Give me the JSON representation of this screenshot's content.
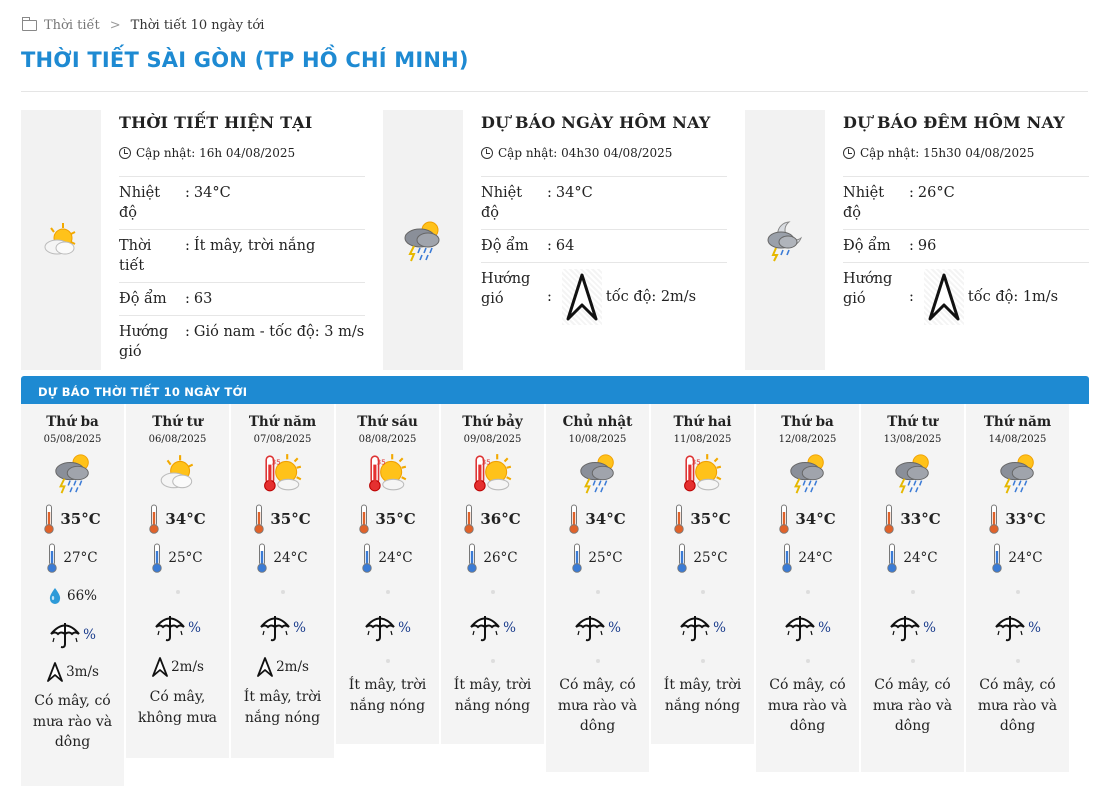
{
  "breadcrumb": {
    "root": "Thời tiết",
    "current": "Thời tiết 10 ngày tới"
  },
  "page_title": "THỜI TIẾT SÀI GÒN (TP HỒ CHÍ MINH)",
  "cards": [
    {
      "title": "THỜI TIẾT HIỆN TẠI",
      "updated": "Cập nhật: 16h 04/08/2025",
      "icon": "sun-cloud-icon",
      "rows": [
        {
          "k": "Nhiệt độ",
          "v": "34°C"
        },
        {
          "k": "Thời tiết",
          "v": "Ít mây, trời nắng"
        },
        {
          "k": "Độ ẩm",
          "v": "63"
        },
        {
          "k": "Hướng gió",
          "v": "Gió nam - tốc độ: 3 m/s"
        }
      ]
    },
    {
      "title": "DỰ BÁO NGÀY HÔM NAY",
      "updated": "Cập nhật: 04h30 04/08/2025",
      "icon": "thunderstorm-icon",
      "rows": [
        {
          "k": "Nhiệt độ",
          "v": "34°C"
        },
        {
          "k": "Độ ẩm",
          "v": "64"
        }
      ],
      "wind_label": "Hướng gió",
      "wind_speed": "tốc độ: 2m/s"
    },
    {
      "title": "DỰ BÁO ĐÊM HÔM NAY",
      "updated": "Cập nhật: 15h30 04/08/2025",
      "icon": "moon-storm-icon",
      "rows": [
        {
          "k": "Nhiệt độ",
          "v": "26°C"
        },
        {
          "k": "Độ ẩm",
          "v": "96"
        }
      ],
      "wind_label": "Hướng gió",
      "wind_speed": "tốc độ: 1m/s"
    }
  ],
  "ten_day_title": "DỰ BÁO THỜI TIẾT 10 NGÀY TỚI",
  "days": [
    {
      "name": "Thứ ba",
      "date": "05/08/2025",
      "icon": "thunderstorm",
      "max": "35°C",
      "min": "27°C",
      "humidity": "66%",
      "rain": "%",
      "wind": "3m/s",
      "desc": "Có mây, có mưa rào và dông"
    },
    {
      "name": "Thứ tư",
      "date": "06/08/2025",
      "icon": "sun-cloud",
      "max": "34°C",
      "min": "25°C",
      "humidity": "",
      "rain": "%",
      "wind": "2m/s",
      "desc": "Có mây, không mưa"
    },
    {
      "name": "Thứ năm",
      "date": "07/08/2025",
      "icon": "hot-sun",
      "max": "35°C",
      "min": "24°C",
      "humidity": "",
      "rain": "%",
      "wind": "2m/s",
      "desc": "Ít mây, trời nắng nóng"
    },
    {
      "name": "Thứ sáu",
      "date": "08/08/2025",
      "icon": "hot-sun",
      "max": "35°C",
      "min": "24°C",
      "humidity": "",
      "rain": "%",
      "wind": "",
      "desc": "Ít mây, trời nắng nóng"
    },
    {
      "name": "Thứ bảy",
      "date": "09/08/2025",
      "icon": "hot-sun",
      "max": "36°C",
      "min": "26°C",
      "humidity": "",
      "rain": "%",
      "wind": "",
      "desc": "Ít mây, trời nắng nóng"
    },
    {
      "name": "Chủ nhật",
      "date": "10/08/2025",
      "icon": "thunderstorm",
      "max": "34°C",
      "min": "25°C",
      "humidity": "",
      "rain": "%",
      "wind": "",
      "desc": "Có mây, có mưa rào và dông"
    },
    {
      "name": "Thứ hai",
      "date": "11/08/2025",
      "icon": "hot-sun",
      "max": "35°C",
      "min": "25°C",
      "humidity": "",
      "rain": "%",
      "wind": "",
      "desc": "Ít mây, trời nắng nóng"
    },
    {
      "name": "Thứ ba",
      "date": "12/08/2025",
      "icon": "thunderstorm",
      "max": "34°C",
      "min": "24°C",
      "humidity": "",
      "rain": "%",
      "wind": "",
      "desc": "Có mây, có mưa rào và dông"
    },
    {
      "name": "Thứ tư",
      "date": "13/08/2025",
      "icon": "thunderstorm",
      "max": "33°C",
      "min": "24°C",
      "humidity": "",
      "rain": "%",
      "wind": "",
      "desc": "Có mây, có mưa rào và dông"
    },
    {
      "name": "Thứ năm",
      "date": "14/08/2025",
      "icon": "thunderstorm",
      "max": "33°C",
      "min": "24°C",
      "humidity": "",
      "rain": "%",
      "wind": "",
      "desc": "Có mây, có mưa rào và dông"
    }
  ]
}
